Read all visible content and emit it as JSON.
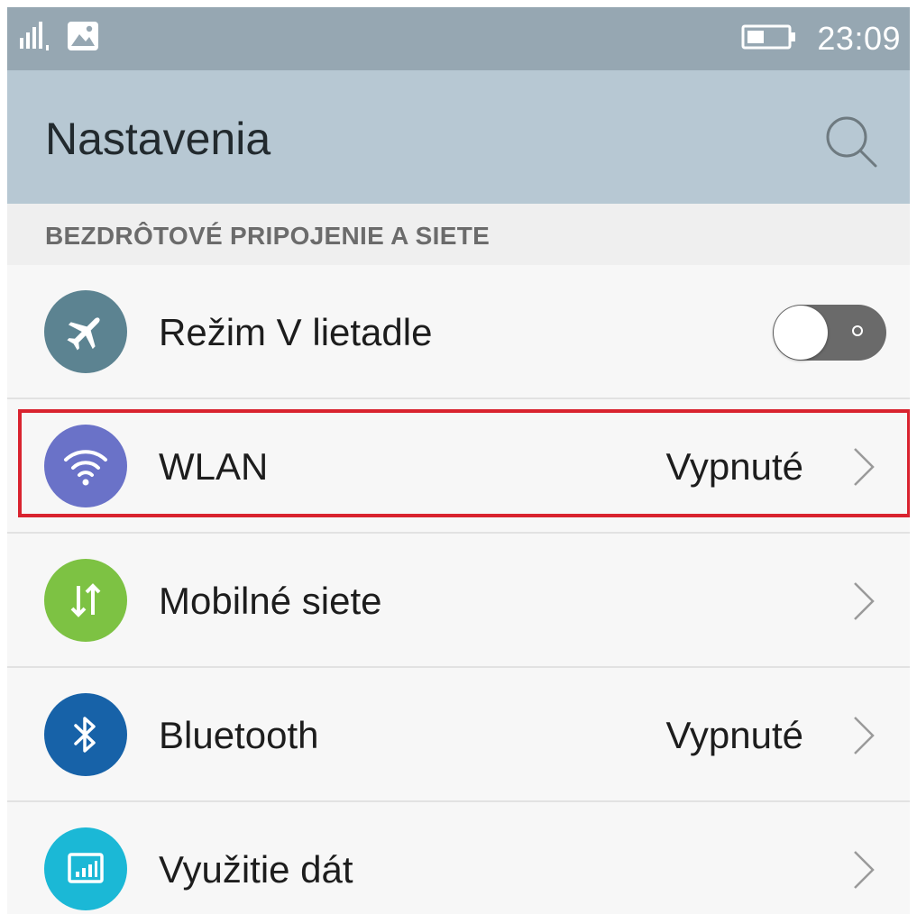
{
  "status_bar": {
    "time": "23:09",
    "signal_icon": "signal-bars-icon",
    "notification_icon": "image-notification-icon",
    "battery_icon": "battery-icon"
  },
  "header": {
    "title": "Nastavenia",
    "search_icon": "search-icon"
  },
  "section": {
    "title": "BEZDRÔTOVÉ PRIPOJENIE A SIETE"
  },
  "items": [
    {
      "label": "Režim V lietadle",
      "value": "",
      "icon": "airplane-icon",
      "icon_color": "#5c8391",
      "control": "toggle",
      "toggle_on": false
    },
    {
      "label": "WLAN",
      "value": "Vypnuté",
      "icon": "wifi-icon",
      "icon_color": "#6a72c8",
      "control": "chevron",
      "highlighted": true
    },
    {
      "label": "Mobilné siete",
      "value": "",
      "icon": "mobile-data-icon",
      "icon_color": "#7dc243",
      "control": "chevron"
    },
    {
      "label": "Bluetooth",
      "value": "Vypnuté",
      "icon": "bluetooth-icon",
      "icon_color": "#1762a8",
      "control": "chevron"
    },
    {
      "label": "Využitie dát",
      "value": "",
      "icon": "data-usage-icon",
      "icon_color": "#1bb8d6",
      "control": "chevron"
    }
  ],
  "colors": {
    "status_bar_bg": "#96a7b2",
    "app_bar_bg": "#b7c8d3",
    "highlight_border": "#d9232f"
  }
}
